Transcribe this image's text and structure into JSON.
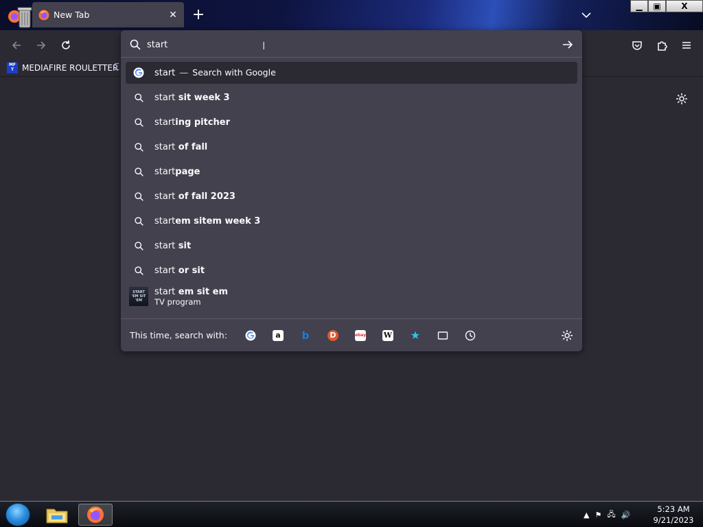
{
  "tab": {
    "title": "New Tab",
    "close": "✕"
  },
  "newtab": "+",
  "window_controls": {
    "minimize": "▁",
    "maximize": "▣",
    "close": "X"
  },
  "bookmarks": [
    {
      "label": "MEDIAFIRE ROULETTER",
      "icon_text": "MF T"
    }
  ],
  "urlbar": {
    "value": "start",
    "results": [
      {
        "type": "engine",
        "typed": "start",
        "separator": "—",
        "action": "Search with Google",
        "icon": "google-icon"
      },
      {
        "type": "suggestion",
        "typed": "start",
        "rest": " sit week 3"
      },
      {
        "type": "suggestion",
        "typed": "start",
        "rest": "ing pitcher"
      },
      {
        "type": "suggestion",
        "typed": "start",
        "rest": " of fall"
      },
      {
        "type": "suggestion",
        "typed": "start",
        "rest": "page"
      },
      {
        "type": "suggestion",
        "typed": "start",
        "rest": " of fall 2023"
      },
      {
        "type": "suggestion",
        "typed": "start",
        "rest": "em sitem week 3"
      },
      {
        "type": "suggestion",
        "typed": "start",
        "rest": " sit"
      },
      {
        "type": "suggestion",
        "typed": "start",
        "rest": " or sit"
      }
    ],
    "rich": {
      "typed": "start",
      "rest": " em sit em",
      "subtitle": "TV program",
      "thumb_text": "START 'EM SIT 'EM"
    },
    "oneoff_label": "This time, search with:",
    "oneoffs": [
      {
        "name": "google",
        "glyph": "G",
        "color": "#4285f4"
      },
      {
        "name": "amazon",
        "glyph": "a",
        "color": "#ff9900"
      },
      {
        "name": "bing",
        "glyph": "b",
        "color": "#1a7dd6"
      },
      {
        "name": "duckduckgo",
        "glyph": "D",
        "color": "#de5833"
      },
      {
        "name": "ebay",
        "glyph": "ebay",
        "color": "#e53238"
      },
      {
        "name": "wikipedia",
        "glyph": "W",
        "color": "#111111"
      },
      {
        "name": "bookmarks",
        "glyph": "★",
        "color": "#2ec4f0"
      },
      {
        "name": "tabs",
        "glyph": "▭",
        "color": "#fbfbfe"
      },
      {
        "name": "history",
        "glyph": "◷",
        "color": "#fbfbfe"
      }
    ]
  },
  "clock": {
    "time": "5:23 AM",
    "date": "9/21/2023"
  }
}
